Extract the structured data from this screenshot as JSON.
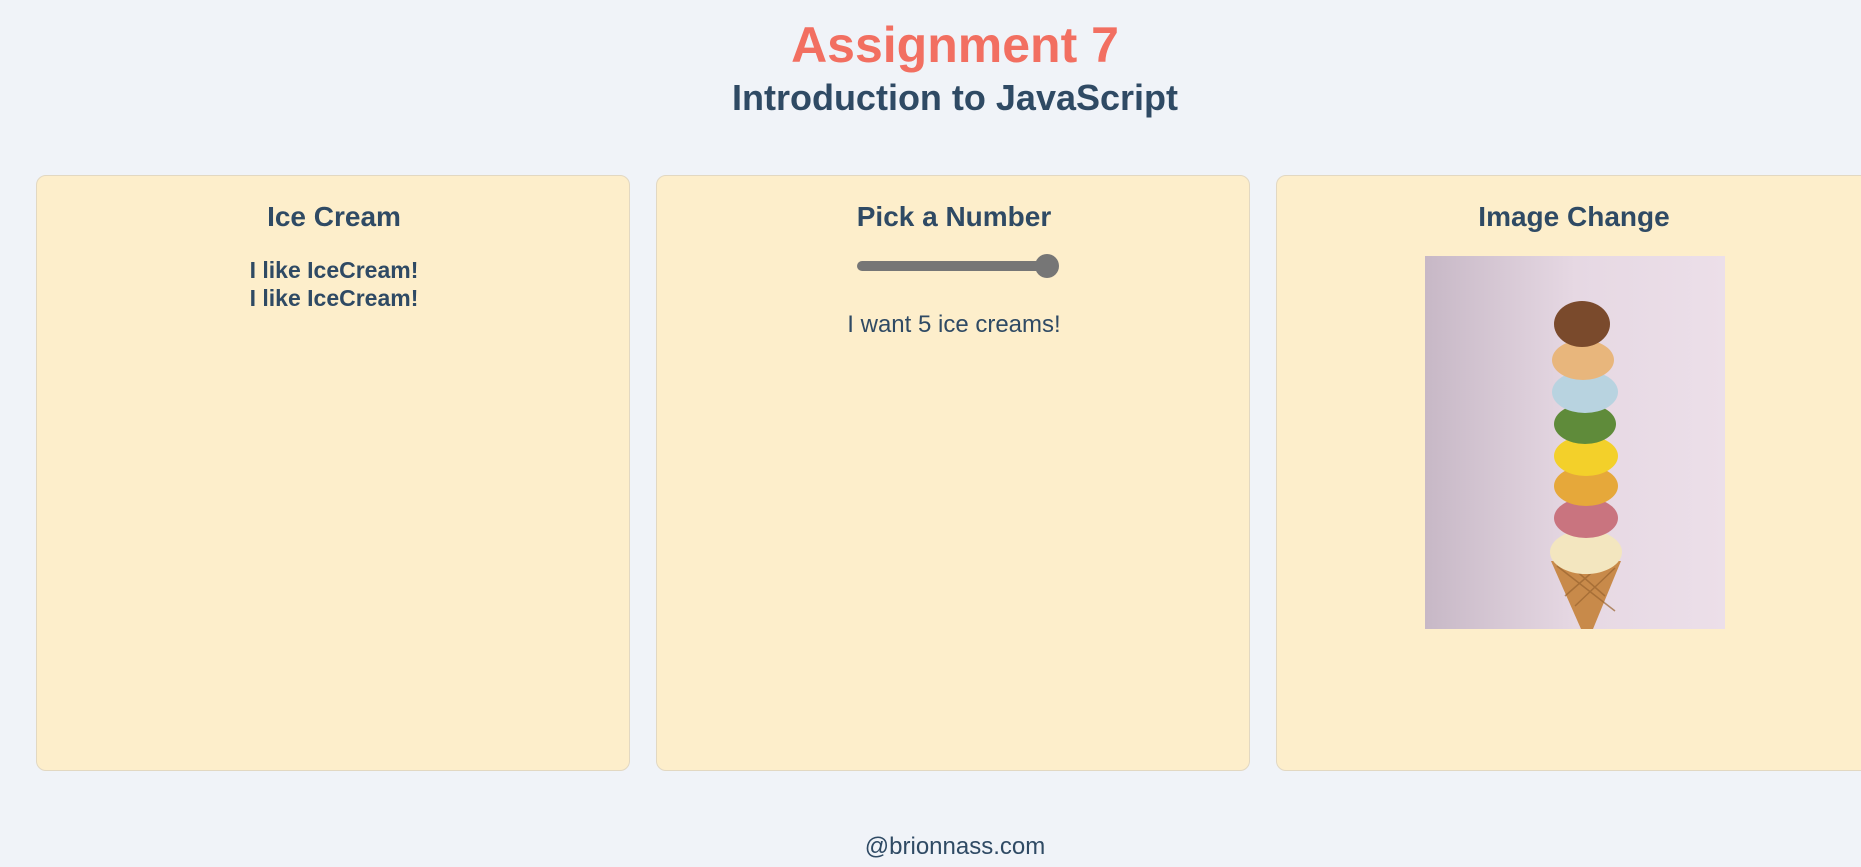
{
  "header": {
    "title": "Assignment 7",
    "subtitle": "Introduction to JavaScript"
  },
  "cards": {
    "ice_cream": {
      "title": "Ice Cream",
      "lines": [
        "I like IceCream!",
        "I like IceCream!"
      ]
    },
    "pick_number": {
      "title": "Pick a Number",
      "slider_value_fraction": 1.0,
      "message": "I want 5 ice creams!"
    },
    "image_change": {
      "title": "Image Change",
      "image": "ice-cream-cone-stack"
    }
  },
  "footer": {
    "text": "@brionnass.com"
  },
  "colors": {
    "background": "#f0f3f8",
    "card": "#fdeecb",
    "title_accent": "#f26f61",
    "text": "#2f4a64",
    "slider": "#767676"
  }
}
